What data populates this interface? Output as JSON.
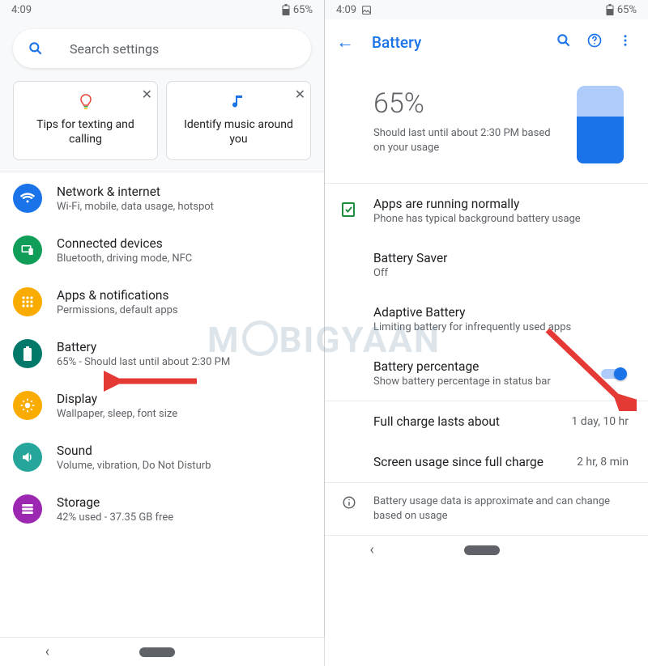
{
  "status": {
    "time": "4:09",
    "battery_pct": "65%"
  },
  "left": {
    "search_placeholder": "Search settings",
    "cards": [
      {
        "title": "Tips for texting and calling"
      },
      {
        "title": "Identify music around you"
      }
    ],
    "items": [
      {
        "title": "Network & internet",
        "sub": "Wi-Fi, mobile, data usage, hotspot"
      },
      {
        "title": "Connected devices",
        "sub": "Bluetooth, driving mode, NFC"
      },
      {
        "title": "Apps & notifications",
        "sub": "Permissions, default apps"
      },
      {
        "title": "Battery",
        "sub": "65% - Should last until about 2:30 PM"
      },
      {
        "title": "Display",
        "sub": "Wallpaper, sleep, font size"
      },
      {
        "title": "Sound",
        "sub": "Volume, vibration, Do Not Disturb"
      },
      {
        "title": "Storage",
        "sub": "42% used - 37.35 GB free"
      }
    ]
  },
  "right": {
    "title": "Battery",
    "hero_pct": "65%",
    "hero_sub": "Should last until about 2:30 PM based on your usage",
    "rows": {
      "running": {
        "t": "Apps are running normally",
        "s": "Phone has typical background battery usage"
      },
      "saver": {
        "t": "Battery Saver",
        "s": "Off"
      },
      "adaptive": {
        "t": "Adaptive Battery",
        "s": "Limiting battery for infrequently used apps"
      },
      "percentage": {
        "t": "Battery percentage",
        "s": "Show battery percentage in status bar"
      },
      "full": {
        "t": "Full charge lasts about",
        "v": "1 day, 10 hr"
      },
      "screen": {
        "t": "Screen usage since full charge",
        "v": "2 hr, 8 min"
      }
    },
    "info": "Battery usage data is approximate and can change based on usage"
  },
  "watermark": "MOBIGYAAN"
}
